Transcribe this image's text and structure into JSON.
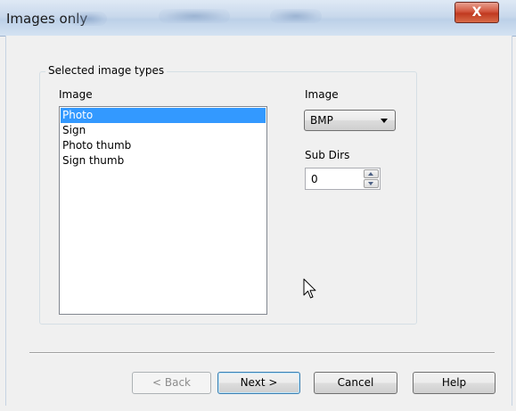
{
  "window": {
    "title": "Images only",
    "close_glyph": "X"
  },
  "group": {
    "label": "Selected image types"
  },
  "image_list": {
    "label": "Image",
    "items": [
      "Photo",
      "Sign",
      "Photo thumb",
      "Sign thumb"
    ],
    "selected": "Photo"
  },
  "image_format": {
    "label": "Image",
    "value": "BMP"
  },
  "sub_dirs": {
    "label": "Sub Dirs",
    "value": "0"
  },
  "buttons": {
    "back": "< Back",
    "next": "Next >",
    "cancel": "Cancel",
    "help": "Help"
  },
  "colors": {
    "selection": "#3399ff",
    "close_button": "#c0391f",
    "default_button_border": "#3c7fb1"
  }
}
